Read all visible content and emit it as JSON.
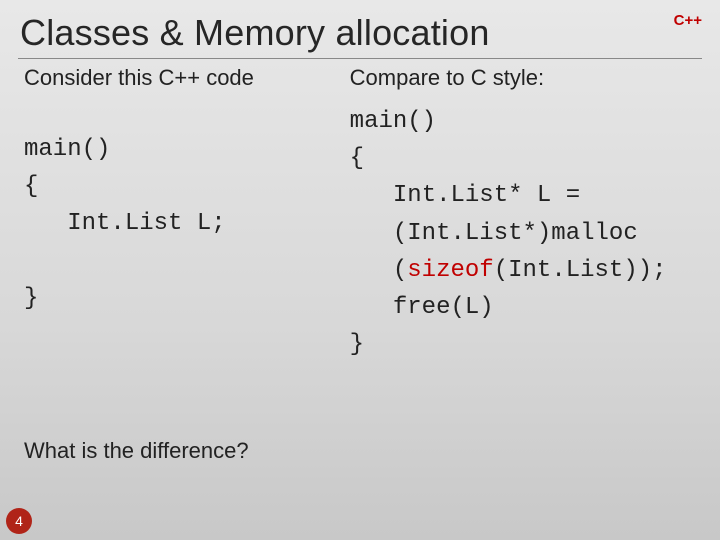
{
  "corner_tag": "C++",
  "title": "Classes & Memory allocation",
  "page_number": "4",
  "left": {
    "subhead": "Consider this C++ code",
    "code_lines": [
      "main()",
      "{",
      "   Int.List L;",
      "",
      "}"
    ]
  },
  "right": {
    "subhead": "Compare to C style:",
    "code_line_1": "main()",
    "code_line_2": "{",
    "code_line_3_indent": "   ",
    "code_line_3_rest": "Int.List* L =",
    "code_line_4": "   (Int.List*)malloc",
    "code_line_5a": "   (",
    "code_line_5_kw": "sizeof",
    "code_line_5b": "(Int.List));",
    "code_line_6": "   free(L)",
    "code_line_7": "}"
  },
  "footer_question": "What is the difference?"
}
